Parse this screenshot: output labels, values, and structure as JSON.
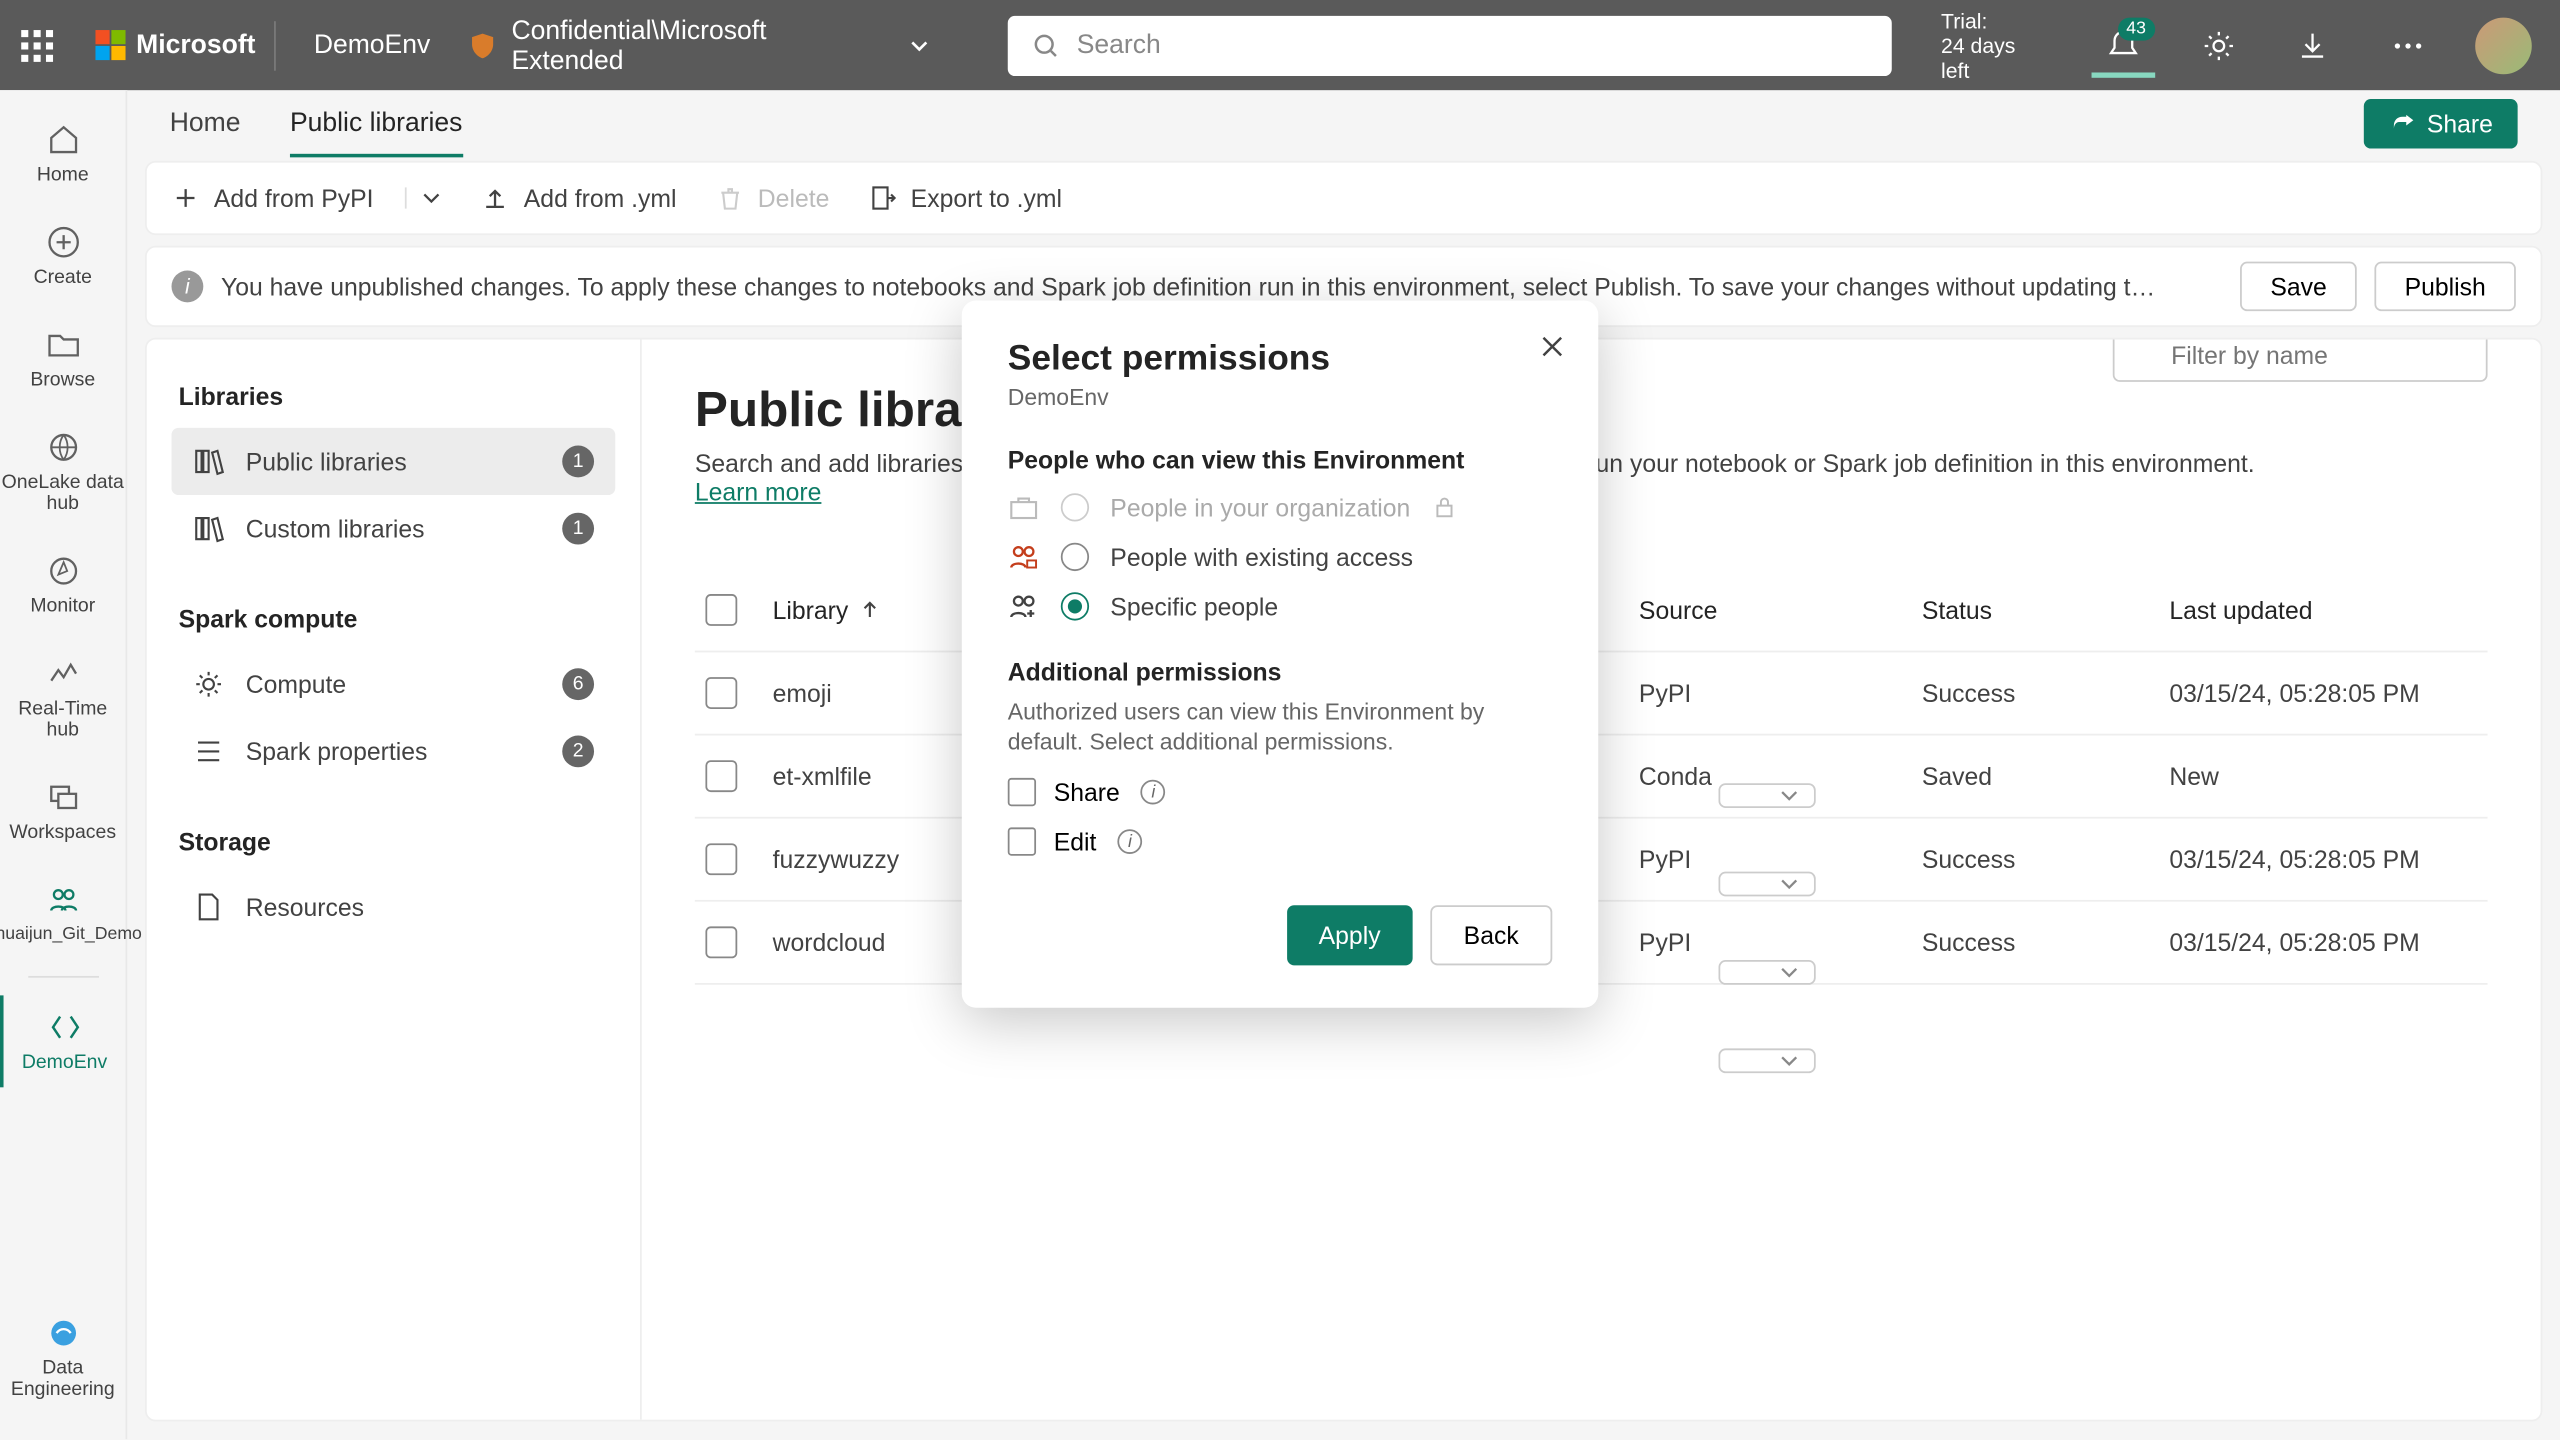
{
  "topbar": {
    "brand": "Microsoft",
    "env_name": "DemoEnv",
    "sensitivity": "Confidential\\Microsoft Extended",
    "search_placeholder": "Search",
    "trial_line1": "Trial:",
    "trial_line2": "24 days left",
    "notification_badge": "43"
  },
  "leftrail": {
    "items": [
      "Home",
      "Create",
      "Browse",
      "OneLake data hub",
      "Monitor",
      "Real-Time hub",
      "Workspaces",
      "Shuaijun_Git_Demo",
      "DemoEnv"
    ],
    "bottom": "Data Engineering"
  },
  "tabs": {
    "home": "Home",
    "public_libraries": "Public libraries",
    "share": "Share"
  },
  "toolbar": {
    "add_pypi": "Add from PyPI",
    "add_yml": "Add from .yml",
    "delete": "Delete",
    "export_yml": "Export to .yml"
  },
  "banner": {
    "text": "You have unpublished changes. To apply these changes to notebooks and Spark job definition run in this environment, select Publish. To save your changes without updating the environment, sel...",
    "save": "Save",
    "publish": "Publish"
  },
  "sidenav": {
    "libraries_title": "Libraries",
    "public_libraries": "Public libraries",
    "public_libraries_count": "1",
    "custom_libraries": "Custom libraries",
    "custom_libraries_count": "1",
    "spark_title": "Spark compute",
    "compute": "Compute",
    "compute_count": "6",
    "spark_properties": "Spark properties",
    "spark_properties_count": "2",
    "storage_title": "Storage",
    "resources": "Resources"
  },
  "page": {
    "title": "Public libraries",
    "desc_1": "Search and add libraries from public feed. The public libraries are available if you run your notebook or Spark job definition in this environment. ",
    "learn_more": "Learn more",
    "filter_placeholder": "Filter by name"
  },
  "table": {
    "headers": {
      "library": "Library",
      "source": "Source",
      "status": "Status",
      "last_updated": "Last updated"
    },
    "rows": [
      {
        "name": "emoji",
        "source": "PyPI",
        "status": "Success",
        "updated": "03/15/24, 05:28:05 PM"
      },
      {
        "name": "et-xmlfile",
        "source": "Conda",
        "status": "Saved",
        "updated": "New"
      },
      {
        "name": "fuzzywuzzy",
        "source": "PyPI",
        "status": "Success",
        "updated": "03/15/24, 05:28:05 PM"
      },
      {
        "name": "wordcloud",
        "source": "PyPI",
        "status": "Success",
        "updated": "03/15/24, 05:28:05 PM"
      }
    ]
  },
  "modal": {
    "title": "Select permissions",
    "subtitle": "DemoEnv",
    "section_view": "People who can view this Environment",
    "opt_org": "People in your organization",
    "opt_existing": "People with existing access",
    "opt_specific": "Specific people",
    "section_additional": "Additional permissions",
    "additional_desc": "Authorized users can view this Environment by default. Select additional permissions.",
    "share": "Share",
    "edit": "Edit",
    "apply": "Apply",
    "back": "Back"
  }
}
